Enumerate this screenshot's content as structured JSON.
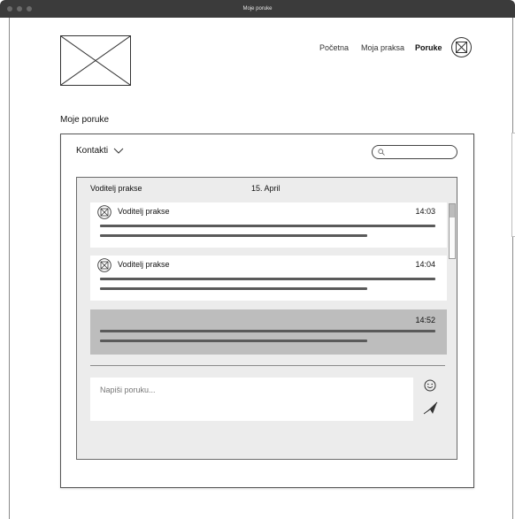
{
  "window": {
    "title": "Moje poruke"
  },
  "header": {
    "nav": [
      {
        "label": "Početna"
      },
      {
        "label": "Moja praksa"
      },
      {
        "label": "Poruke"
      }
    ]
  },
  "page": {
    "title": "Moje poruke"
  },
  "contacts": {
    "label": "Kontakti"
  },
  "search": {
    "placeholder": ""
  },
  "chat": {
    "name": "Voditelj prakse",
    "date": "15. April",
    "messages": [
      {
        "sender": "Voditelj prakse",
        "time": "14:03"
      },
      {
        "sender": "Voditelj prakse",
        "time": "14:04"
      },
      {
        "sender": "",
        "time": "14:52"
      }
    ]
  },
  "composer": {
    "placeholder": "Napiši poruku..."
  },
  "colors": {
    "own_message_bg": "#bdbdbd",
    "chat_bg": "#ececec",
    "titlebar": "#3b3b3b"
  }
}
